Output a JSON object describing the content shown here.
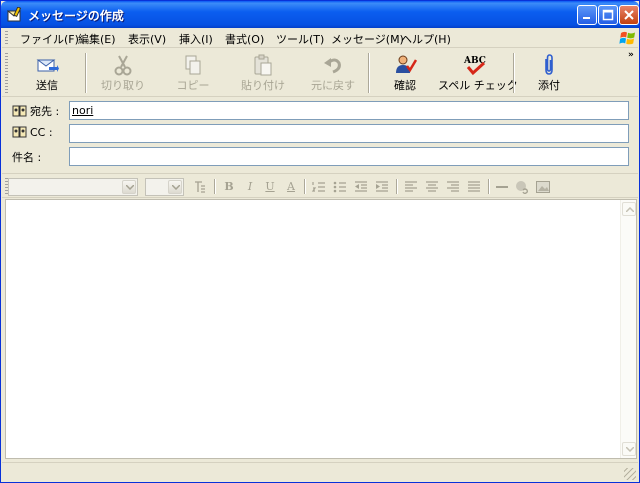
{
  "window": {
    "title": "メッセージの作成",
    "accent_color": "#0a58f4",
    "title_icon": "compose-message-icon"
  },
  "menubar": {
    "items": [
      {
        "label": "ファイル(F)"
      },
      {
        "label": "編集(E)"
      },
      {
        "label": "表示(V)"
      },
      {
        "label": "挿入(I)"
      },
      {
        "label": "書式(O)"
      },
      {
        "label": "ツール(T)"
      },
      {
        "label": "メッセージ(M)"
      },
      {
        "label": "ヘルプ(H)"
      }
    ]
  },
  "toolbar": {
    "send": {
      "label": "送信",
      "icon": "send-icon",
      "enabled": true
    },
    "cut": {
      "label": "切り取り",
      "icon": "scissors-icon",
      "enabled": false
    },
    "copy": {
      "label": "コピー",
      "icon": "copy-icon",
      "enabled": false
    },
    "paste": {
      "label": "貼り付け",
      "icon": "paste-icon",
      "enabled": false
    },
    "undo": {
      "label": "元に戻す",
      "icon": "undo-icon",
      "enabled": false
    },
    "check": {
      "label": "確認",
      "icon": "check-names-icon",
      "enabled": true
    },
    "spell": {
      "label": "スペル チェック",
      "icon": "spellcheck-icon",
      "enabled": true
    },
    "attach": {
      "label": "添付",
      "icon": "paperclip-icon",
      "enabled": true
    },
    "overflow": "»"
  },
  "fields": {
    "to": {
      "label": "宛先 :",
      "value": "nori"
    },
    "cc": {
      "label": "CC :",
      "value": ""
    },
    "subject": {
      "label": "件名 :",
      "value": ""
    }
  },
  "format_toolbar": {
    "font_name": "",
    "font_size": "",
    "buttons": [
      "paragraph-style-icon",
      "bold-icon",
      "italic-icon",
      "underline-icon",
      "font-color-icon",
      "numbered-list-icon",
      "bullet-list-icon",
      "decrease-indent-icon",
      "increase-indent-icon",
      "align-left-icon",
      "align-center-icon",
      "align-right-icon",
      "justify-icon",
      "horizontal-line-icon",
      "hyperlink-icon",
      "insert-picture-icon"
    ],
    "glyphs": {
      "bold": "B",
      "italic": "I",
      "underline": "U",
      "font_color": "A"
    }
  },
  "editor": {
    "body_text": ""
  }
}
